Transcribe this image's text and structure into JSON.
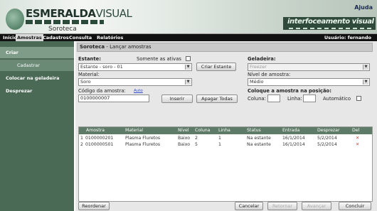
{
  "app": {
    "logo_main": "ESMERALDA",
    "logo_main2": "VISUAL",
    "logo_sub": "Soroteca",
    "help": "Ajuda",
    "partner_logo": "interfoceamento visual"
  },
  "menu": {
    "items": [
      "Início",
      "Amostras",
      "Cadastros",
      "Consulta",
      "Relatórios"
    ],
    "active_index": 1,
    "user": "Usuário: fernando"
  },
  "sidebar": {
    "items": [
      {
        "label": "Criar",
        "selected": true
      },
      {
        "label": "Cadastrar",
        "sub": true
      },
      {
        "label": "Colocar na geladeira"
      },
      {
        "label": "Desprezar"
      }
    ]
  },
  "page": {
    "title_bold": "Soroteca",
    "title_rest": " - Lançar amostras"
  },
  "form": {
    "estante_label": "Estante:",
    "only_active_label": "Somente as ativas",
    "estante_value": "Estante - soro - 01",
    "criar_estante_btn": "Criar Estante",
    "material_label": "Material:",
    "material_value": "Soro",
    "codigo_label": "Código da amostra:",
    "codigo_link": "Auto",
    "codigo_value": "0100000007",
    "inserir_btn": "Inserir",
    "apagar_btn": "Apagar Todas",
    "geladeira_label": "Geladeira:",
    "geladeira_value": "Freezer",
    "nivel_label": "Nível de amostra:",
    "nivel_value": "Médio",
    "posicao_label": "Coloque a amostra na posição:",
    "coluna_label": "Coluna:",
    "linha_label": "Linha:",
    "automatico_label": "Automático"
  },
  "table": {
    "columns": [
      "Amostra",
      "Material",
      "Nível",
      "Coluna",
      "Linha",
      "Status",
      "Entrada",
      "Desprezar",
      "Del"
    ],
    "rows": [
      {
        "n": "1",
        "amostra": "0100000201",
        "material": "Plasma Fluretos",
        "nivel": "Baixo",
        "coluna": "2",
        "linha": "1",
        "status": "Na estante",
        "entrada": "16/1/2014",
        "desprezar": "5/2/2014",
        "del": "✕"
      },
      {
        "n": "2",
        "amostra": "0100000501",
        "material": "Plasma Fluretos",
        "nivel": "Baixo",
        "coluna": "5",
        "linha": "1",
        "status": "Na estante",
        "entrada": "16/1/2014",
        "desprezar": "5/2/2014",
        "del": "✕"
      }
    ]
  },
  "footer": {
    "reordenar": "Reordenar",
    "cancelar": "Cancelar",
    "retornar": "Retornar",
    "avancar": "Avançar",
    "concluir": "Concluir"
  }
}
